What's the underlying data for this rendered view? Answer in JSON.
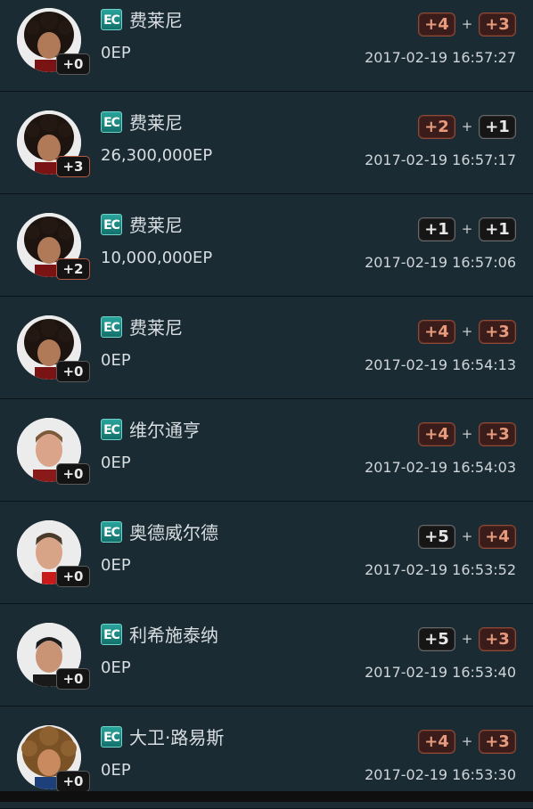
{
  "rows": [
    {
      "name": "费莱尼",
      "ep": "0EP",
      "time": "2017-02-19 16:57:27",
      "level": "+0",
      "level_color": "dark",
      "badge1": "+4",
      "badge1_color": "red",
      "plus": "+",
      "badge2": "+3",
      "badge2_color": "red",
      "avatar": "fellaini-icon",
      "ec": "EC"
    },
    {
      "name": "费莱尼",
      "ep": "26,300,000EP",
      "time": "2017-02-19 16:57:17",
      "level": "+3",
      "level_color": "red",
      "badge1": "+2",
      "badge1_color": "red",
      "plus": "+",
      "badge2": "+1",
      "badge2_color": "dark",
      "avatar": "fellaini-icon",
      "ec": "EC"
    },
    {
      "name": "费莱尼",
      "ep": "10,000,000EP",
      "time": "2017-02-19 16:57:06",
      "level": "+2",
      "level_color": "red",
      "badge1": "+1",
      "badge1_color": "dark",
      "plus": "+",
      "badge2": "+1",
      "badge2_color": "dark",
      "avatar": "fellaini-icon",
      "ec": "EC"
    },
    {
      "name": "费莱尼",
      "ep": "0EP",
      "time": "2017-02-19 16:54:13",
      "level": "+0",
      "level_color": "dark",
      "badge1": "+4",
      "badge1_color": "red",
      "plus": "+",
      "badge2": "+3",
      "badge2_color": "red",
      "avatar": "fellaini-icon",
      "ec": "EC"
    },
    {
      "name": "维尔通亨",
      "ep": "0EP",
      "time": "2017-02-19 16:54:03",
      "level": "+0",
      "level_color": "dark",
      "badge1": "+4",
      "badge1_color": "red",
      "plus": "+",
      "badge2": "+3",
      "badge2_color": "red",
      "avatar": "player-portrait-icon",
      "ec": "EC"
    },
    {
      "name": "奥德威尔德",
      "ep": "0EP",
      "time": "2017-02-19 16:53:52",
      "level": "+0",
      "level_color": "dark",
      "badge1": "+5",
      "badge1_color": "dark",
      "plus": "+",
      "badge2": "+4",
      "badge2_color": "red",
      "avatar": "player-portrait-icon",
      "ec": "EC"
    },
    {
      "name": "利希施泰纳",
      "ep": "0EP",
      "time": "2017-02-19 16:53:40",
      "level": "+0",
      "level_color": "dark",
      "badge1": "+5",
      "badge1_color": "dark",
      "plus": "+",
      "badge2": "+3",
      "badge2_color": "red",
      "avatar": "player-portrait-icon",
      "ec": "EC"
    },
    {
      "name": "大卫·路易斯",
      "ep": "0EP",
      "time": "2017-02-19 16:53:30",
      "level": "+0",
      "level_color": "dark",
      "badge1": "+4",
      "badge1_color": "red",
      "plus": "+",
      "badge2": "+3",
      "badge2_color": "red",
      "avatar": "curly-hair-portrait-icon",
      "ec": "EC"
    }
  ]
}
